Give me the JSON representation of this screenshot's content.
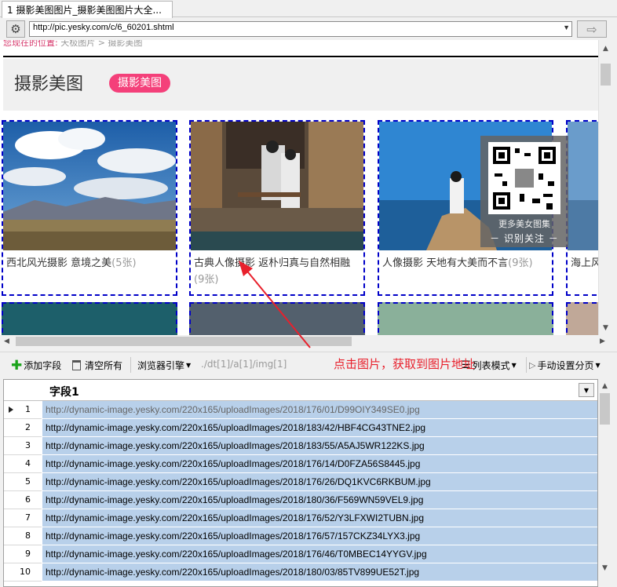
{
  "tab": {
    "title": "1  摄影美图图片_摄影美图图片大全..."
  },
  "address": {
    "url": "http://pic.yesky.com/c/6_60201.shtml"
  },
  "page": {
    "breadcrumb_prefix": "您现在的位置:",
    "breadcrumb_rest": " 天极图片 > 摄影美图",
    "title": "摄影美图",
    "pill": "摄影美图"
  },
  "cards": [
    {
      "caption": "西北风光摄影 意境之美",
      "count": "(5张)"
    },
    {
      "caption": "古典人像摄影 返朴归真与自然相融",
      "count": "(9张)"
    },
    {
      "caption": "人像摄影 天地有大美而不言",
      "count": "(9张)"
    },
    {
      "caption": "海上风",
      "count": ""
    }
  ],
  "qr": {
    "line1": "更多美女图集",
    "line2": "－ 识别关注 －"
  },
  "toolbar": {
    "add_field": "添加字段",
    "clear_all": "清空所有",
    "browser_ref": "浏览器引擎",
    "xpath": "./dt[1]/a[1]/img[1]",
    "list_mode": "列表模式",
    "manual_paging": "手动设置分页"
  },
  "annotation": "点击图片，获取到图片地址",
  "grid": {
    "header": "字段1",
    "rows": [
      {
        "n": "1",
        "v": "http://dynamic-image.yesky.com/220x165/uploadImages/2018/176/01/D99OIY349SE0.jpg"
      },
      {
        "n": "2",
        "v": "http://dynamic-image.yesky.com/220x165/uploadImages/2018/183/42/HBF4CG43TNE2.jpg"
      },
      {
        "n": "3",
        "v": "http://dynamic-image.yesky.com/220x165/uploadImages/2018/183/55/A5AJ5WR122KS.jpg"
      },
      {
        "n": "4",
        "v": "http://dynamic-image.yesky.com/220x165/uploadImages/2018/176/14/D0FZA56S8445.jpg"
      },
      {
        "n": "5",
        "v": "http://dynamic-image.yesky.com/220x165/uploadImages/2018/176/26/DQ1KVC6RKBUM.jpg"
      },
      {
        "n": "6",
        "v": "http://dynamic-image.yesky.com/220x165/uploadImages/2018/180/36/F569WN59VEL9.jpg"
      },
      {
        "n": "7",
        "v": "http://dynamic-image.yesky.com/220x165/uploadImages/2018/176/52/Y3LFXWI2TUBN.jpg"
      },
      {
        "n": "8",
        "v": "http://dynamic-image.yesky.com/220x165/uploadImages/2018/176/57/157CKZ34LYX3.jpg"
      },
      {
        "n": "9",
        "v": "http://dynamic-image.yesky.com/220x165/uploadImages/2018/176/46/T0MBEC14YYGV.jpg"
      },
      {
        "n": "10",
        "v": "http://dynamic-image.yesky.com/220x165/uploadImages/2018/180/03/85TV899UE52T.jpg"
      }
    ]
  }
}
